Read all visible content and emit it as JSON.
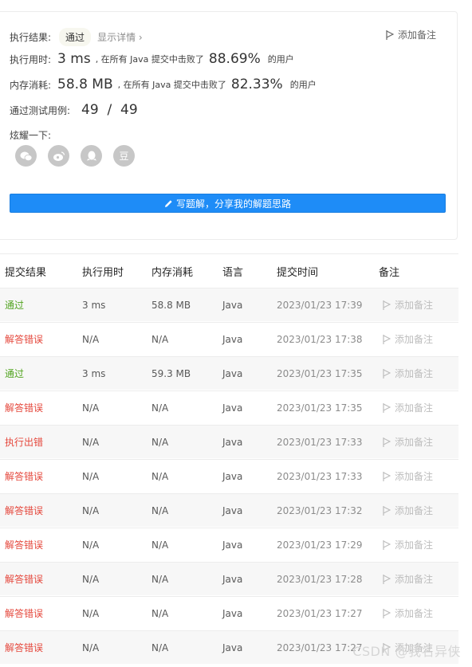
{
  "summary": {
    "result_label": "执行结果:",
    "result_value": "通过",
    "show_details": "显示详情 ›",
    "add_note": "添加备注",
    "time_label": "执行用时:",
    "time_value": "3 ms",
    "time_text": ", 在所有 Java 提交中击败了",
    "time_pct": "88.69%",
    "time_suffix": "的用户",
    "mem_label": "内存消耗:",
    "mem_value": "58.8 MB",
    "mem_text": ", 在所有 Java 提交中击败了",
    "mem_pct": "82.33%",
    "mem_suffix": "的用户",
    "cases_label": "通过测试用例:",
    "cases_value": "49  /  49",
    "share_label": "炫耀一下:",
    "share_icons": [
      "wechat-icon",
      "weibo-icon",
      "qq-icon",
      "douban-icon"
    ],
    "douban_glyph": "豆",
    "write_button": "写题解，分享我的解题思路"
  },
  "table": {
    "headers": [
      "提交结果",
      "执行用时",
      "内存消耗",
      "语言",
      "提交时间",
      "备注"
    ],
    "rows": [
      {
        "result": "通过",
        "status": "ok",
        "time": "3 ms",
        "mem": "58.8 MB",
        "lang": "Java",
        "submitted": "2023/01/23 17:39",
        "note": "添加备注"
      },
      {
        "result": "解答错误",
        "status": "err",
        "time": "N/A",
        "mem": "N/A",
        "lang": "Java",
        "submitted": "2023/01/23 17:38",
        "note": "添加备注"
      },
      {
        "result": "通过",
        "status": "ok",
        "time": "3 ms",
        "mem": "59.3 MB",
        "lang": "Java",
        "submitted": "2023/01/23 17:35",
        "note": "添加备注"
      },
      {
        "result": "解答错误",
        "status": "err",
        "time": "N/A",
        "mem": "N/A",
        "lang": "Java",
        "submitted": "2023/01/23 17:35",
        "note": "添加备注"
      },
      {
        "result": "执行出错",
        "status": "err",
        "time": "N/A",
        "mem": "N/A",
        "lang": "Java",
        "submitted": "2023/01/23 17:33",
        "note": "添加备注"
      },
      {
        "result": "解答错误",
        "status": "err",
        "time": "N/A",
        "mem": "N/A",
        "lang": "Java",
        "submitted": "2023/01/23 17:33",
        "note": "添加备注"
      },
      {
        "result": "解答错误",
        "status": "err",
        "time": "N/A",
        "mem": "N/A",
        "lang": "Java",
        "submitted": "2023/01/23 17:32",
        "note": "添加备注"
      },
      {
        "result": "解答错误",
        "status": "err",
        "time": "N/A",
        "mem": "N/A",
        "lang": "Java",
        "submitted": "2023/01/23 17:29",
        "note": "添加备注"
      },
      {
        "result": "解答错误",
        "status": "err",
        "time": "N/A",
        "mem": "N/A",
        "lang": "Java",
        "submitted": "2023/01/23 17:28",
        "note": "添加备注"
      },
      {
        "result": "解答错误",
        "status": "err",
        "time": "N/A",
        "mem": "N/A",
        "lang": "Java",
        "submitted": "2023/01/23 17:27",
        "note": "添加备注"
      },
      {
        "result": "解答错误",
        "status": "err",
        "time": "N/A",
        "mem": "N/A",
        "lang": "Java",
        "submitted": "2023/01/23 17:27",
        "note": "添加备注"
      }
    ]
  },
  "watermark": "CSDN @我名异侠",
  "colors": {
    "accent": "#1e8cf7",
    "ok": "#52a420",
    "err": "#e5483d"
  }
}
